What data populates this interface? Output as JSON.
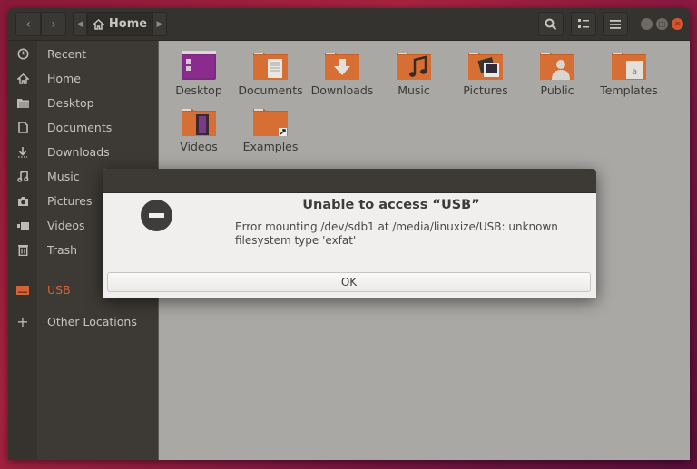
{
  "headerbar": {
    "back_icon": "chevron-left-icon",
    "forward_icon": "chevron-right-icon",
    "path_label": "Home",
    "path_icon": "home-icon",
    "search_icon": "search-icon",
    "view_icon": "list-view-icon",
    "menu_icon": "hamburger-menu-icon",
    "window_controls": [
      "minimize",
      "maximize",
      "close"
    ]
  },
  "sidebar": {
    "items": [
      {
        "label": "Recent",
        "icon": "clock-icon"
      },
      {
        "label": "Home",
        "icon": "home-icon"
      },
      {
        "label": "Desktop",
        "icon": "folder-icon"
      },
      {
        "label": "Documents",
        "icon": "document-icon"
      },
      {
        "label": "Downloads",
        "icon": "download-icon"
      },
      {
        "label": "Music",
        "icon": "music-icon"
      },
      {
        "label": "Pictures",
        "icon": "camera-icon"
      },
      {
        "label": "Videos",
        "icon": "video-icon"
      },
      {
        "label": "Trash",
        "icon": "trash-icon"
      },
      {
        "label": "USB",
        "icon": "drive-icon"
      },
      {
        "label": "Other Locations",
        "icon": "plus-icon"
      }
    ]
  },
  "files": [
    {
      "name": "Desktop",
      "type": "desktop"
    },
    {
      "name": "Documents",
      "type": "documents"
    },
    {
      "name": "Downloads",
      "type": "downloads"
    },
    {
      "name": "Music",
      "type": "music"
    },
    {
      "name": "Pictures",
      "type": "pictures"
    },
    {
      "name": "Public",
      "type": "public"
    },
    {
      "name": "Templates",
      "type": "templates"
    },
    {
      "name": "Videos",
      "type": "videos"
    },
    {
      "name": "Examples",
      "type": "examples"
    }
  ],
  "dialog": {
    "title": "Unable to access “USB”",
    "message": "Error mounting /dev/sdb1 at /media/linuxize/USB: unknown filesystem type 'exfat'",
    "ok_label": "OK",
    "icon": "error-icon"
  },
  "colors": {
    "accent": "#d2643a",
    "folder_orange": "#d76f35",
    "desktop_purple": "#8a2c8e"
  }
}
